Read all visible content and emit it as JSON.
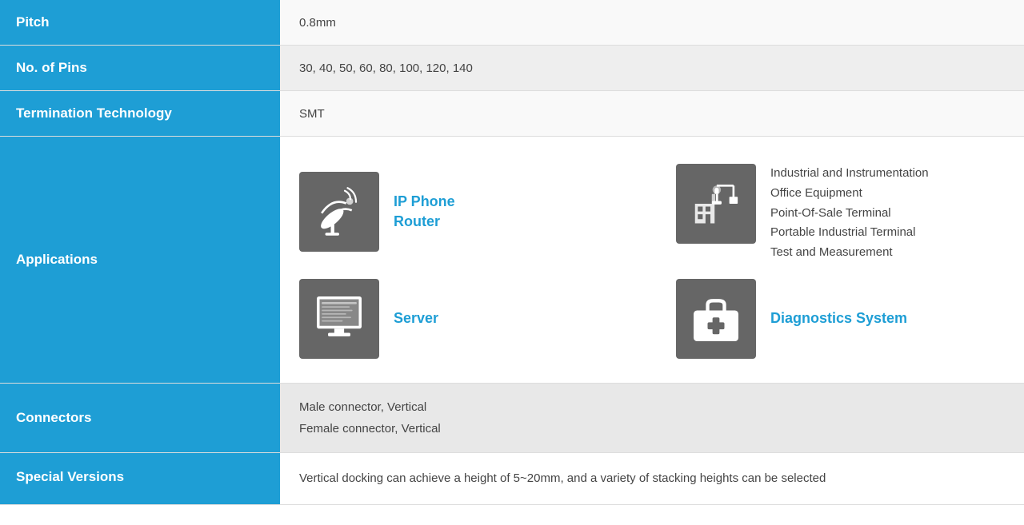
{
  "rows": {
    "pitch": {
      "label": "Pitch",
      "value": "0.8mm"
    },
    "no_of_pins": {
      "label": "No. of Pins",
      "value": "30, 40, 50, 60, 80, 100, 120, 140"
    },
    "termination_technology": {
      "label": "Termination Technology",
      "value": "SMT"
    },
    "applications": {
      "label": "Applications",
      "items": [
        {
          "icon": "satellite",
          "label_line1": "IP Phone",
          "label_line2": "Router",
          "multi": false
        },
        {
          "icon": "industrial",
          "label_line1": "Industrial and Instrumentation",
          "label_line2": "Office Equipment",
          "label_line3": "Point-Of-Sale Terminal",
          "label_line4": "Portable Industrial Terminal",
          "label_line5": "Test and Measurement",
          "multi": true
        },
        {
          "icon": "server",
          "label_line1": "Server",
          "multi": false
        },
        {
          "icon": "diagnostics",
          "label_line1": "Diagnostics System",
          "multi": false
        }
      ]
    },
    "connectors": {
      "label": "Connectors",
      "line1": "Male connector, Vertical",
      "line2": "Female connector, Vertical"
    },
    "special_versions": {
      "label": "Special Versions",
      "value": "Vertical docking can achieve a height of 5~20mm, and a variety of stacking heights can be selected"
    }
  }
}
